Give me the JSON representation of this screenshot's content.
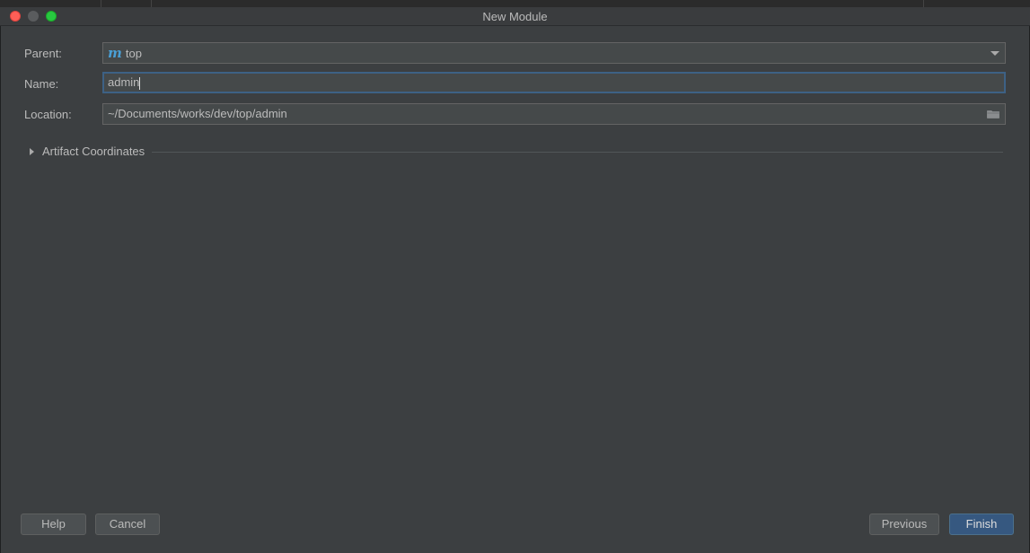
{
  "window": {
    "title": "New Module"
  },
  "form": {
    "parent": {
      "label": "Parent:",
      "icon": "m-module-icon",
      "icon_glyph": "m",
      "value": "top"
    },
    "name": {
      "label": "Name:",
      "value": "admin"
    },
    "location": {
      "label": "Location:",
      "value": "~/Documents/works/dev/top/admin"
    }
  },
  "section": {
    "label": "Artifact Coordinates"
  },
  "buttons": {
    "help": "Help",
    "cancel": "Cancel",
    "previous": "Previous",
    "finish": "Finish"
  },
  "colors": {
    "background": "#3c3f41",
    "field": "#45494a",
    "focus_border": "#3d6185",
    "primary_button": "#365880",
    "close": "#fe5f57",
    "maximize": "#28c840"
  }
}
